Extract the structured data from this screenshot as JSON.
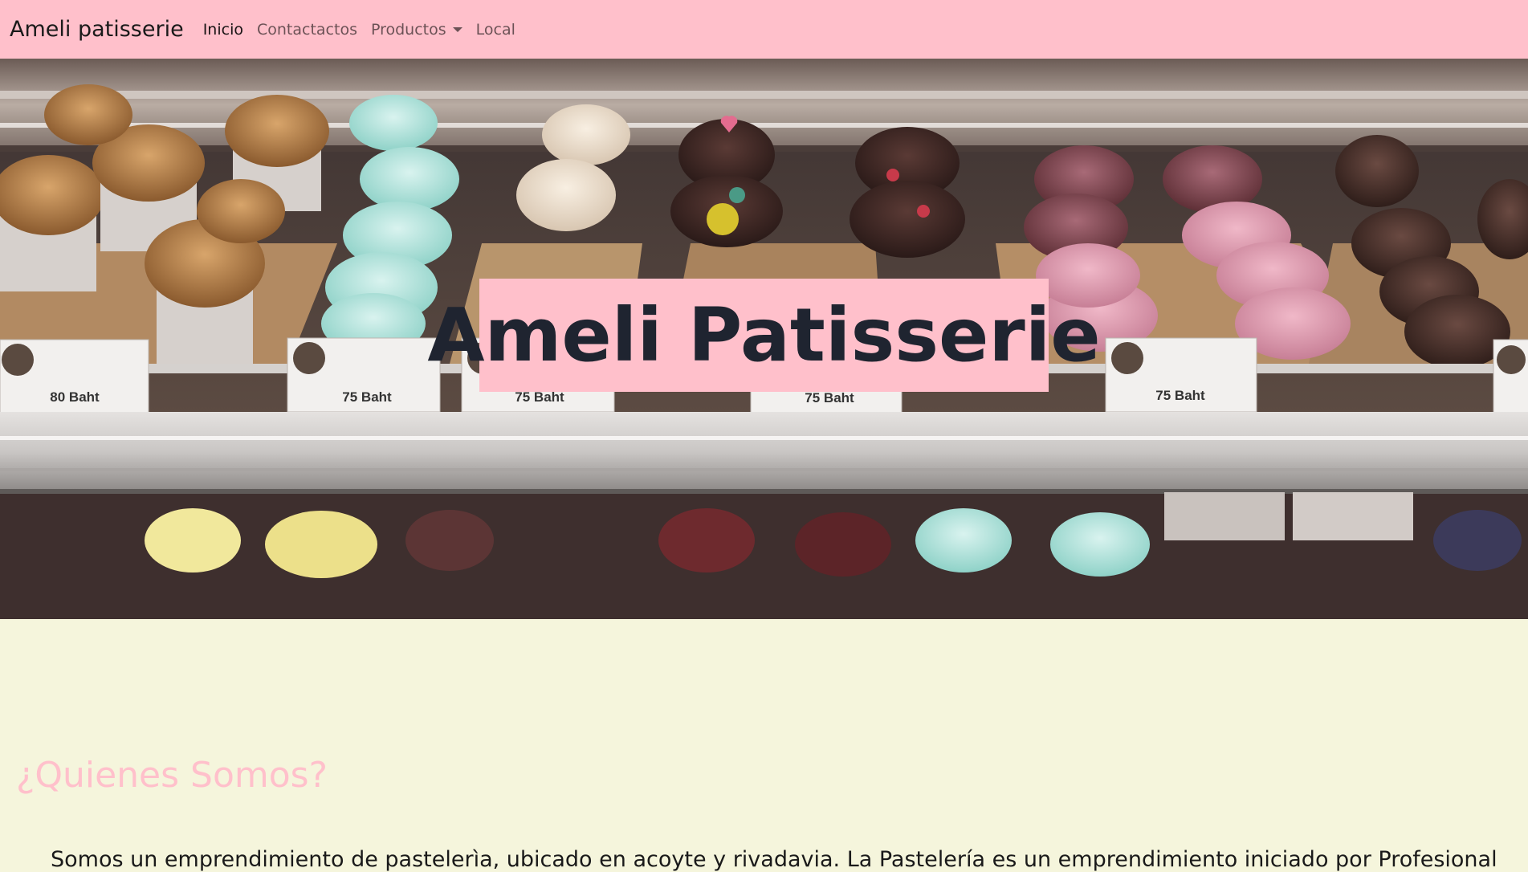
{
  "navbar": {
    "brand": "Ameli patisserie",
    "links": [
      {
        "label": "Inicio",
        "active": true
      },
      {
        "label": "Contactactos",
        "active": false
      },
      {
        "label": "Productos",
        "active": false,
        "dropdown": true
      },
      {
        "label": "Local",
        "active": false
      }
    ],
    "bg_color": "#ffc0cb"
  },
  "hero": {
    "title": "Ameli Patisserie",
    "image": "cupcake-display-case-photo",
    "price_tags": [
      {
        "price": "80 Baht"
      },
      {
        "price": "75 Baht"
      },
      {
        "price": "75 Baht"
      },
      {
        "price": "75 Baht"
      },
      {
        "price": "75 Baht"
      }
    ]
  },
  "about": {
    "title": "¿Quienes Somos?",
    "text": "Somos un emprendimiento de pastelerìa, ubicado en acoyte y rivadavia. La Pastelería es un emprendimiento iniciado por Profesionales",
    "title_color": "#ffc0cb"
  },
  "page": {
    "bg_color": "#f5f5dc"
  }
}
